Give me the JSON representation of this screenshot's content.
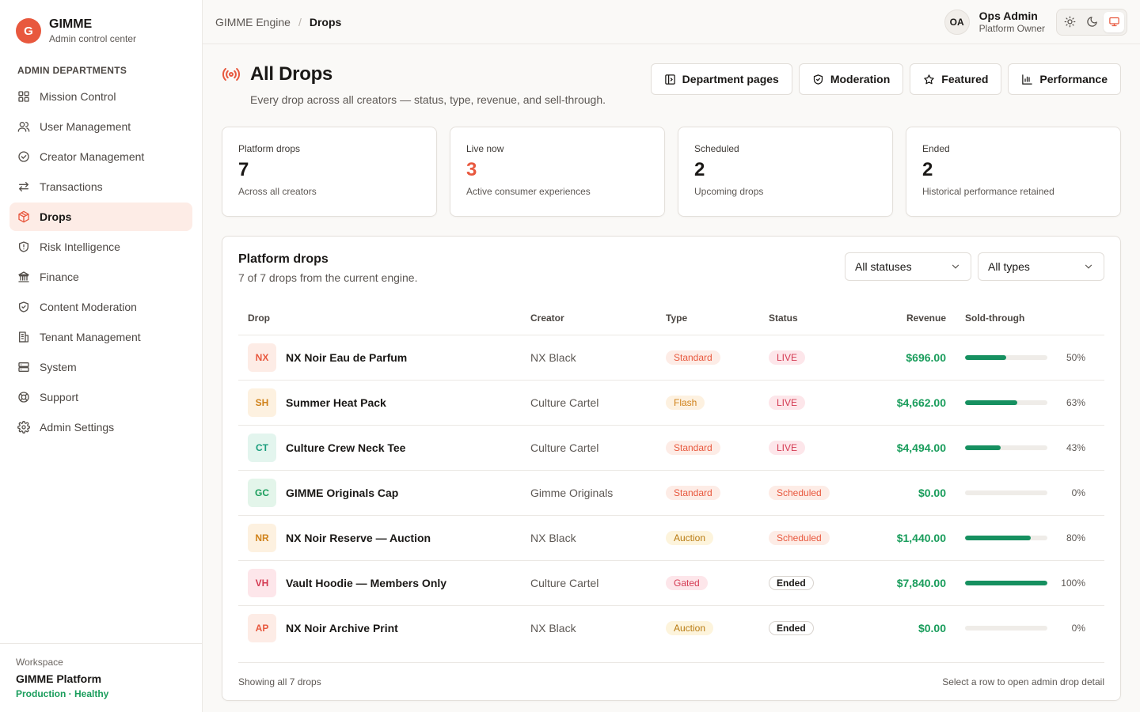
{
  "brand": {
    "initial": "G",
    "name": "GIMME",
    "subtitle": "Admin control center"
  },
  "sidebar": {
    "section_title": "ADMIN DEPARTMENTS",
    "items": [
      {
        "label": "Mission Control",
        "icon": "grid-icon"
      },
      {
        "label": "User Management",
        "icon": "users-icon"
      },
      {
        "label": "Creator Management",
        "icon": "check-circle-icon"
      },
      {
        "label": "Transactions",
        "icon": "arrows-icon"
      },
      {
        "label": "Drops",
        "icon": "box-icon",
        "active": true
      },
      {
        "label": "Risk Intelligence",
        "icon": "shield-alert-icon"
      },
      {
        "label": "Finance",
        "icon": "bank-icon"
      },
      {
        "label": "Content Moderation",
        "icon": "shield-check-icon"
      },
      {
        "label": "Tenant Management",
        "icon": "building-icon"
      },
      {
        "label": "System",
        "icon": "server-icon"
      },
      {
        "label": "Support",
        "icon": "lifebuoy-icon"
      },
      {
        "label": "Admin Settings",
        "icon": "gear-icon"
      }
    ]
  },
  "workspace": {
    "label": "Workspace",
    "name": "GIMME Platform",
    "status": "Production · Healthy"
  },
  "topbar": {
    "breadcrumb_root": "GIMME Engine",
    "breadcrumb_separator": "/",
    "breadcrumb_current": "Drops",
    "user_initials": "OA",
    "user_name": "Ops Admin",
    "user_role": "Platform Owner",
    "theme_selected": "system"
  },
  "page": {
    "title": "All Drops",
    "description": "Every drop across all creators — status, type, revenue, and sell-through.",
    "actions": {
      "department_pages": "Department pages",
      "moderation": "Moderation",
      "featured": "Featured",
      "performance": "Performance"
    }
  },
  "stats": [
    {
      "label": "Platform drops",
      "value": "7",
      "sub": "Across all creators"
    },
    {
      "label": "Live now",
      "value": "3",
      "sub": "Active consumer experiences",
      "accent": "#e8583e"
    },
    {
      "label": "Scheduled",
      "value": "2",
      "sub": "Upcoming drops"
    },
    {
      "label": "Ended",
      "value": "2",
      "sub": "Historical performance retained"
    }
  ],
  "panel": {
    "title": "Platform drops",
    "subtitle": "7 of 7 drops from the current engine.",
    "status_filter": "All statuses",
    "type_filter": "All types",
    "columns": {
      "drop": "Drop",
      "creator": "Creator",
      "type": "Type",
      "status": "Status",
      "revenue": "Revenue",
      "sold": "Sold-through"
    },
    "rows": [
      {
        "initials": "NX",
        "name": "NX Noir Eau de Parfum",
        "creator": "NX Black",
        "type": "Standard",
        "status": "LIVE",
        "revenue": "$696.00",
        "sold": 50,
        "sold_label": "50%",
        "tile_bg": "#fdece6",
        "tile_fg": "#e8583e"
      },
      {
        "initials": "SH",
        "name": "Summer Heat Pack",
        "creator": "Culture Cartel",
        "type": "Flash",
        "status": "LIVE",
        "revenue": "$4,662.00",
        "sold": 63,
        "sold_label": "63%",
        "tile_bg": "#fdf1e0",
        "tile_fg": "#d0821a"
      },
      {
        "initials": "CT",
        "name": "Culture Crew Neck Tee",
        "creator": "Culture Cartel",
        "type": "Standard",
        "status": "LIVE",
        "revenue": "$4,494.00",
        "sold": 43,
        "sold_label": "43%",
        "tile_bg": "#e3f5ee",
        "tile_fg": "#1a9d7c"
      },
      {
        "initials": "GC",
        "name": "GIMME Originals Cap",
        "creator": "Gimme Originals",
        "type": "Standard",
        "status": "Scheduled",
        "revenue": "$0.00",
        "sold": 0,
        "sold_label": "0%",
        "tile_bg": "#e3f5ea",
        "tile_fg": "#1a9d5c"
      },
      {
        "initials": "NR",
        "name": "NX Noir Reserve — Auction",
        "creator": "NX Black",
        "type": "Auction",
        "status": "Scheduled",
        "revenue": "$1,440.00",
        "sold": 80,
        "sold_label": "80%",
        "tile_bg": "#fdf1e0",
        "tile_fg": "#d0821a"
      },
      {
        "initials": "VH",
        "name": "Vault Hoodie — Members Only",
        "creator": "Culture Cartel",
        "type": "Gated",
        "status": "Ended",
        "revenue": "$7,840.00",
        "sold": 100,
        "sold_label": "100%",
        "tile_bg": "#fde6ea",
        "tile_fg": "#d43a52"
      },
      {
        "initials": "AP",
        "name": "NX Noir Archive Print",
        "creator": "NX Black",
        "type": "Auction",
        "status": "Ended",
        "revenue": "$0.00",
        "sold": 0,
        "sold_label": "0%",
        "tile_bg": "#fdece6",
        "tile_fg": "#e8583e"
      }
    ],
    "footer_left": "Showing all 7 drops",
    "footer_right": "Select a row to open admin drop detail"
  },
  "colors": {
    "accent": "#e8583e",
    "revenue": "#1a9d5c",
    "progress": "#169060",
    "type_standard": {
      "bg": "#fdece6",
      "fg": "#e8583e"
    },
    "type_flash": {
      "bg": "#fdf1e0",
      "fg": "#d0821a"
    },
    "type_auction": {
      "bg": "#fdf4dc",
      "fg": "#b87a10"
    },
    "type_gated": {
      "bg": "#fde6ea",
      "fg": "#d43a52"
    },
    "status_live": {
      "bg": "#fde6ea",
      "fg": "#d43a52"
    },
    "status_scheduled": {
      "bg": "#fdece6",
      "fg": "#e8583e"
    },
    "status_ended": {
      "bg": "#ffffff",
      "fg": "#1a1816"
    }
  }
}
